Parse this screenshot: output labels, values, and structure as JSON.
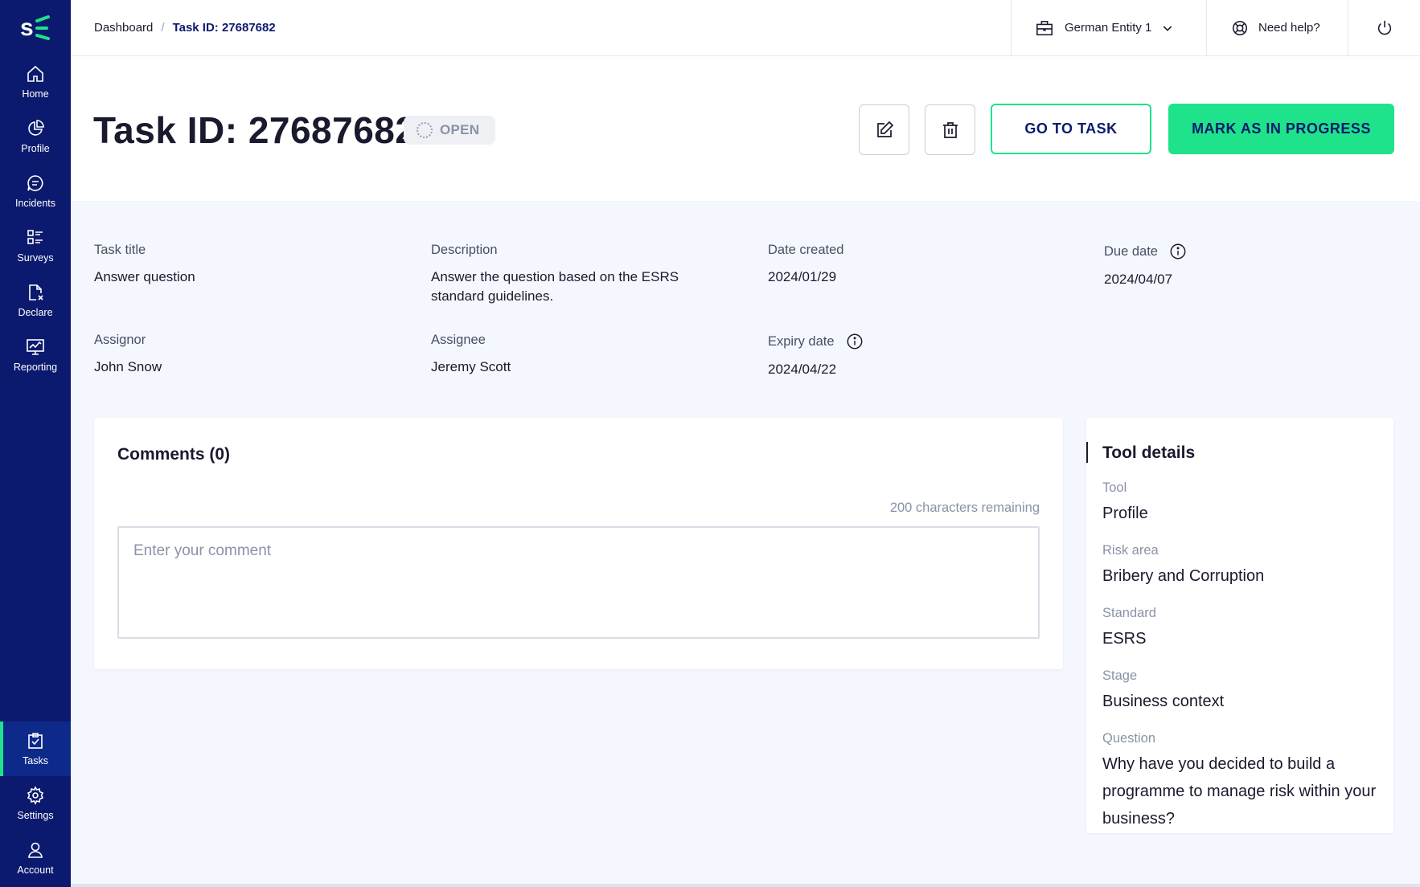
{
  "sidebar": {
    "logo": "S",
    "top_items": [
      {
        "label": "Home",
        "icon": "home-icon"
      },
      {
        "label": "Profile",
        "icon": "pie-chart-icon"
      },
      {
        "label": "Incidents",
        "icon": "chat-bubble-icon"
      },
      {
        "label": "Surveys",
        "icon": "checklist-icon"
      },
      {
        "label": "Declare",
        "icon": "document-x-icon"
      },
      {
        "label": "Reporting",
        "icon": "monitor-chart-icon"
      }
    ],
    "bottom_items": [
      {
        "label": "Tasks",
        "icon": "clipboard-check-icon",
        "active": true
      },
      {
        "label": "Settings",
        "icon": "gear-icon"
      },
      {
        "label": "Account",
        "icon": "user-icon"
      }
    ],
    "accent_color": "#1ee38a",
    "background_color": "#0b1a6e"
  },
  "topbar": {
    "breadcrumb": {
      "root": "Dashboard",
      "separator": "/",
      "current": "Task ID: 27687682"
    },
    "entity": "German Entity 1",
    "help": "Need help?"
  },
  "header": {
    "title": "Task ID: 27687682",
    "status": "OPEN",
    "go_to_task": "GO TO TASK",
    "mark_in_progress": "MARK AS IN PROGRESS"
  },
  "details": {
    "task_title": {
      "label": "Task title",
      "value": "Answer question"
    },
    "description": {
      "label": "Description",
      "value": "Answer the question based on the ESRS standard guidelines."
    },
    "date_created": {
      "label": "Date created",
      "value": "2024/01/29"
    },
    "due_date": {
      "label": "Due date",
      "value": "2024/04/07"
    },
    "assignor": {
      "label": "Assignor",
      "value": "John Snow"
    },
    "assignee": {
      "label": "Assignee",
      "value": "Jeremy Scott"
    },
    "expiry_date": {
      "label": "Expiry date",
      "value": "2024/04/22"
    }
  },
  "comments": {
    "title": "Comments (0)",
    "remaining": "200 characters remaining",
    "placeholder": "Enter your comment"
  },
  "tool_details": {
    "title": "Tool details",
    "tool": {
      "label": "Tool",
      "value": "Profile"
    },
    "risk_area": {
      "label": "Risk area",
      "value": "Bribery and Corruption"
    },
    "standard": {
      "label": "Standard",
      "value": "ESRS"
    },
    "stage": {
      "label": "Stage",
      "value": "Business context"
    },
    "question": {
      "label": "Question",
      "value": "Why have you decided to build a programme to manage risk within your business?"
    }
  }
}
